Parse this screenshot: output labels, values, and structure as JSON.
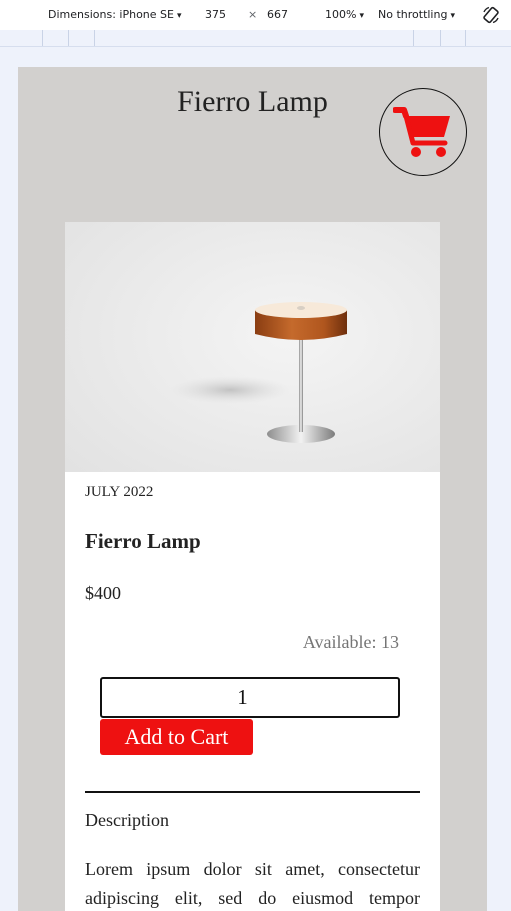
{
  "devtools": {
    "device": "Dimensions: iPhone SE",
    "width": "375",
    "times": "×",
    "height": "667",
    "zoom": "100%",
    "throttling": "No throttling",
    "caret": "▾"
  },
  "header": {
    "title": "Fierro Lamp",
    "cart_icon_color": "#ee1111"
  },
  "product": {
    "date": "JULY 2022",
    "name": "Fierro Lamp",
    "price": "$400",
    "available": "Available: 13",
    "quantity": "1",
    "add_to_cart": "Add to Cart",
    "description_heading": "Description",
    "description_text": "Lorem ipsum dolor sit amet, consectetur adipiscing elit, sed do eiusmod tempor incididunt ut labore et dolore magna aliqua."
  },
  "colors": {
    "page_bg": "#d2d0ce",
    "accent": "#ee1111",
    "muted_text": "#757575"
  }
}
